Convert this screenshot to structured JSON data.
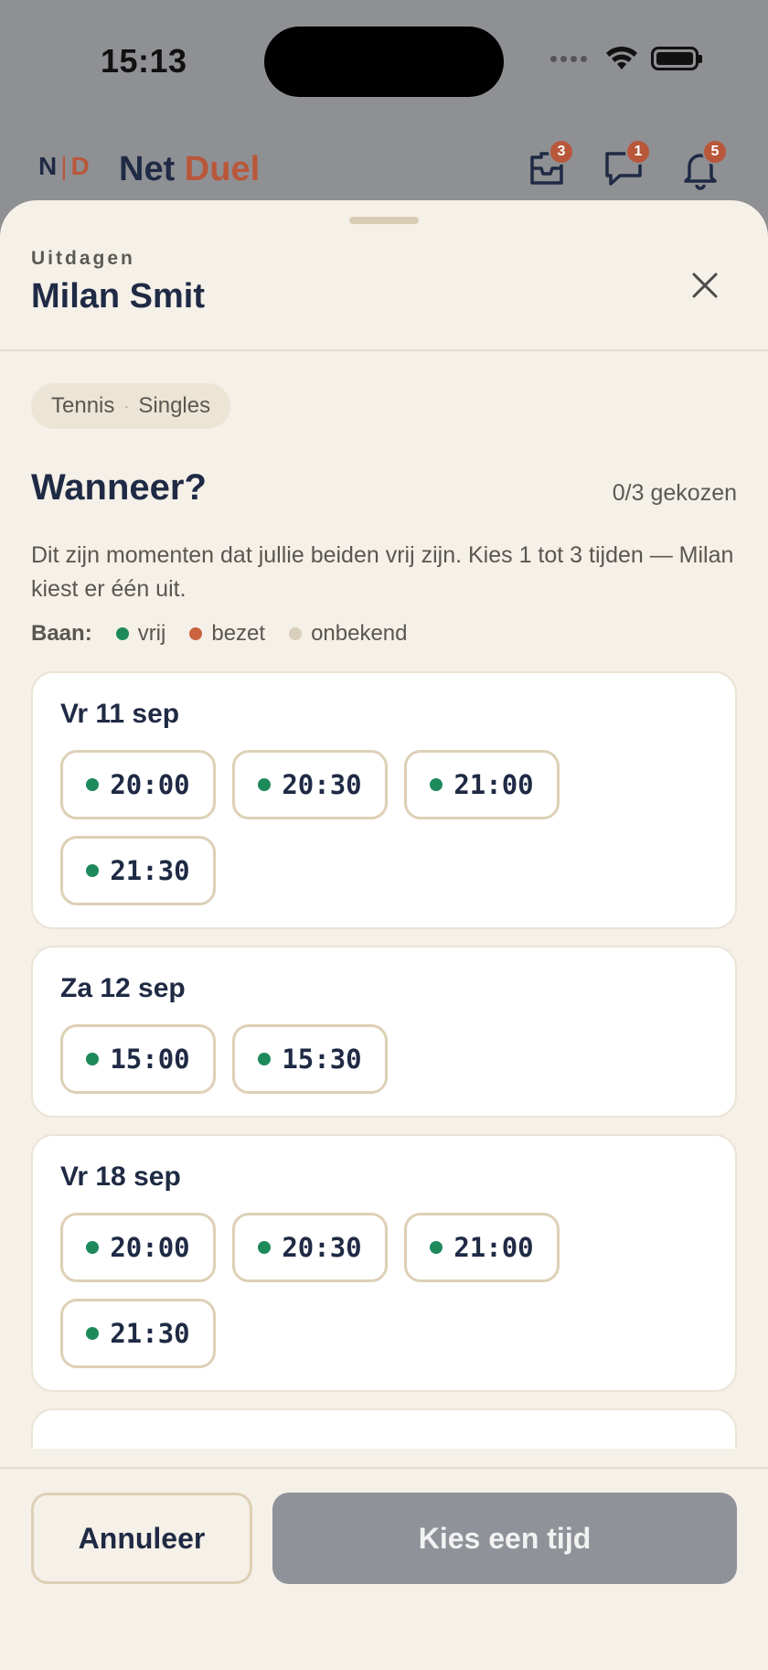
{
  "status_bar": {
    "time": "15:13"
  },
  "app": {
    "logo_left": "N",
    "logo_right": "D",
    "name_part1": "Net",
    "name_part2": "Duel",
    "badges": {
      "challenges": "3",
      "messages": "1",
      "notifications": "5"
    }
  },
  "sheet": {
    "eyebrow": "Uitdagen",
    "title": "Milan Smit",
    "chip": {
      "sport": "Tennis",
      "separator": "·",
      "format": "Singles"
    },
    "section_title": "Wanneer?",
    "counter": "0/3 gekozen",
    "description": "Dit zijn momenten dat jullie beiden vrij zijn. Kies 1 tot 3 tijden — Milan kiest er één uit.",
    "legend": {
      "label": "Baan:",
      "items": [
        {
          "label": "vrij",
          "color": "#1e8a5b"
        },
        {
          "label": "bezet",
          "color": "#c9643f"
        },
        {
          "label": "onbekend",
          "color": "#d8cfbd"
        }
      ]
    },
    "days": [
      {
        "title": "Vr 11 sep",
        "slots": [
          "20:00",
          "20:30",
          "21:00",
          "21:30"
        ]
      },
      {
        "title": "Za 12 sep",
        "slots": [
          "15:00",
          "15:30"
        ]
      },
      {
        "title": "Vr 18 sep",
        "slots": [
          "20:00",
          "20:30",
          "21:00",
          "21:30"
        ]
      }
    ],
    "buttons": {
      "cancel": "Annuleer",
      "primary": "Kies een tijd"
    }
  },
  "colors": {
    "accent": "#b9573a",
    "navy": "#1f2a44",
    "free": "#1e8a5b"
  }
}
